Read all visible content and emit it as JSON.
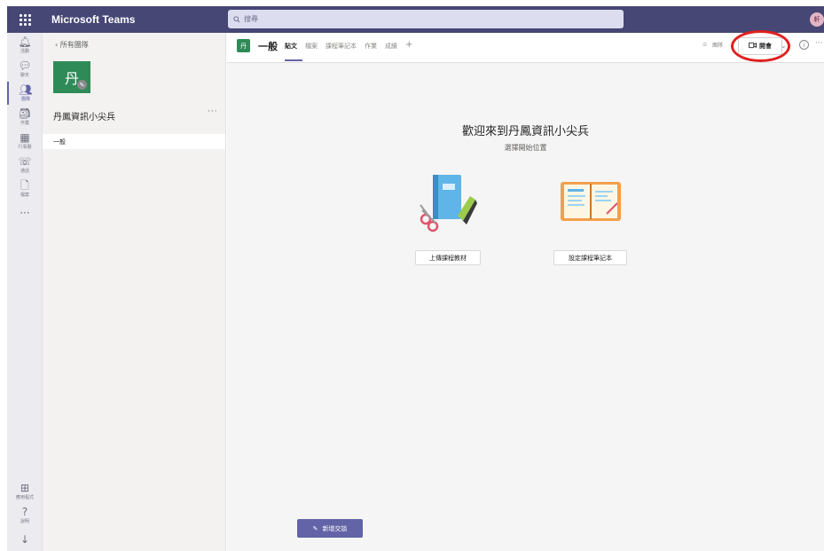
{
  "app": {
    "title": "Microsoft Teams"
  },
  "search": {
    "placeholder": "搜尋"
  },
  "user": {
    "initials": "軒"
  },
  "rail": {
    "items": [
      {
        "name": "activity",
        "label": "活動",
        "glyph": "🔔︎"
      },
      {
        "name": "chat",
        "label": "聊天",
        "glyph": "💬︎"
      },
      {
        "name": "teams",
        "label": "團隊",
        "glyph": "👥︎"
      },
      {
        "name": "assignments",
        "label": "作業",
        "glyph": "🎒︎"
      },
      {
        "name": "calendar",
        "label": "行事曆",
        "glyph": "▦"
      },
      {
        "name": "calls",
        "label": "通話",
        "glyph": "☏"
      },
      {
        "name": "files",
        "label": "檔案",
        "glyph": "🗋"
      },
      {
        "name": "more",
        "label": "",
        "glyph": "···"
      }
    ],
    "bottom": [
      {
        "name": "apps",
        "label": "應用程式",
        "glyph": "⊞"
      },
      {
        "name": "help",
        "label": "說明",
        "glyph": "?"
      },
      {
        "name": "download",
        "label": "",
        "glyph": "↓"
      }
    ]
  },
  "panel": {
    "back": "所有團隊",
    "team_initial": "丹",
    "team_name": "丹鳳資訊小尖兵",
    "more": "···",
    "channels": [
      "一般"
    ]
  },
  "channel": {
    "avatar": "丹",
    "name": "一般",
    "tabs": [
      "貼文",
      "檔案",
      "課程筆記本",
      "作業",
      "成績"
    ],
    "active_tab": 0,
    "add_tab": "+",
    "team_label": "團隊",
    "meet_label": "開會",
    "more": "···"
  },
  "welcome": {
    "title": "歡迎來到丹鳳資訊小尖兵",
    "subtitle": "選擇開始位置",
    "upload_button": "上傳課程教材",
    "notebook_button": "設定課程筆記本"
  },
  "compose": {
    "new_conversation": "新增交談"
  },
  "colors": {
    "topbar": "#464775",
    "accent": "#6264a7",
    "team_tile": "#2e8b57",
    "annotation_ring": "#e02020"
  }
}
